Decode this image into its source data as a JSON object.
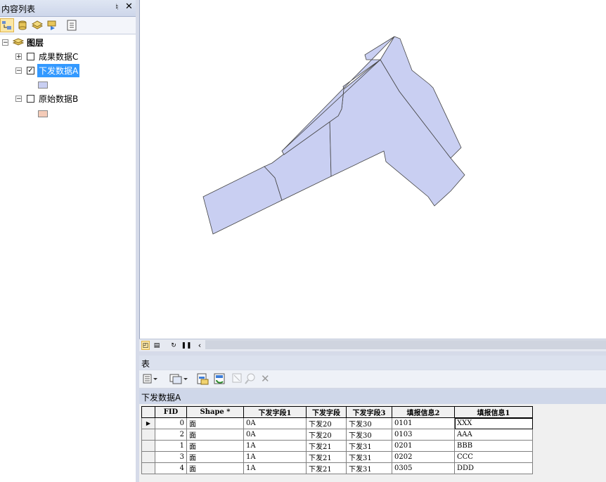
{
  "toc": {
    "title": "内容列表",
    "pin_label": "♮",
    "close_label": "✕",
    "root_label": "图层",
    "layers": [
      {
        "label": "成果数据C",
        "checked": "",
        "expander": "+",
        "swatch": ""
      },
      {
        "label": "下发数据A",
        "checked": "✓",
        "expander": "−",
        "swatch": "#c9cff2"
      },
      {
        "label": "原始数据B",
        "checked": "",
        "expander": "−",
        "swatch": "#f4cbb8"
      }
    ],
    "toolbar_icons": [
      "list-by-drawing-order-icon",
      "list-by-source-icon",
      "list-by-visibility-icon",
      "list-by-selection-icon",
      "options-icon"
    ]
  },
  "map": {
    "fill_color": "#c9cff2",
    "stroke_color": "#444444",
    "scrollbar_icons": [
      "data-view-icon",
      "layout-view-icon",
      "refresh-icon",
      "pause-icon",
      "scroll-left-icon"
    ]
  },
  "table_window": {
    "title": "表",
    "tab_label": "下发数据A",
    "toolbar_icons": [
      "table-options-icon",
      "related-tables-icon",
      "select-by-attributes-icon",
      "switch-selection-icon",
      "clear-selection-icon",
      "zoom-to-selected-icon",
      "delete-selected-icon"
    ],
    "columns": [
      "FID",
      "Shape *",
      "下发字段1",
      "下发字段",
      "下发字段3",
      "填报信息2",
      "填报信息1"
    ],
    "rows": [
      {
        "marker": "▶",
        "fid": "0",
        "shape": "面",
        "f1": "0A",
        "f2": "下发20",
        "f3": "下发30",
        "info2": "0101",
        "info1": "XXX"
      },
      {
        "marker": "",
        "fid": "2",
        "shape": "面",
        "f1": "0A",
        "f2": "下发20",
        "f3": "下发30",
        "info2": "0103",
        "info1": "AAA"
      },
      {
        "marker": "",
        "fid": "1",
        "shape": "面",
        "f1": "1A",
        "f2": "下发21",
        "f3": "下发31",
        "info2": "0201",
        "info1": "BBB"
      },
      {
        "marker": "",
        "fid": "3",
        "shape": "面",
        "f1": "1A",
        "f2": "下发21",
        "f3": "下发31",
        "info2": "0202",
        "info1": "CCC"
      },
      {
        "marker": "",
        "fid": "4",
        "shape": "面",
        "f1": "1A",
        "f2": "下发21",
        "f3": "下发31",
        "info2": "0305",
        "info1": "DDD"
      }
    ]
  }
}
